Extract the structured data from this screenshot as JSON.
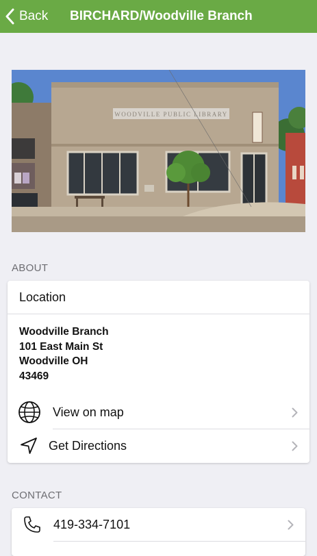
{
  "nav": {
    "back_label": "Back",
    "title": "BIRCHARD/Woodville Branch",
    "bar_color": "#6aaa45"
  },
  "photo": {
    "sign_text": "WOODVILLE PUBLIC LIBRARY"
  },
  "about": {
    "section_label": "ABOUT",
    "card_title": "Location",
    "address_lines": [
      "Woodville Branch",
      "101 East Main St",
      "Woodville OH",
      "43469"
    ],
    "actions": [
      {
        "label": "View on map",
        "icon": "globe-icon"
      },
      {
        "label": "Get Directions",
        "icon": "navigation-arrow-icon"
      }
    ]
  },
  "contact": {
    "section_label": "CONTACT",
    "phone": "419-334-7101",
    "phone_icon": "phone-icon"
  }
}
